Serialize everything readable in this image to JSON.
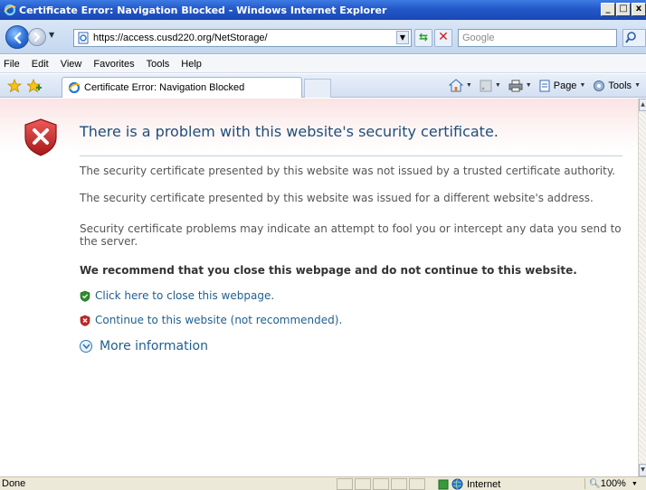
{
  "window": {
    "title": "Certificate Error: Navigation Blocked - Windows Internet Explorer",
    "controls": [
      "_",
      "□",
      "x"
    ]
  },
  "address_bar": {
    "url": "https://access.cusd220.org/NetStorage/",
    "search_placeholder": "Google"
  },
  "menu": {
    "items": [
      "File",
      "Edit",
      "View",
      "Favorites",
      "Tools",
      "Help"
    ]
  },
  "tab": {
    "title": "Certificate Error: Navigation Blocked"
  },
  "command_bar": {
    "page_label": "Page",
    "tools_label": "Tools"
  },
  "content": {
    "headline": "There is a problem with this website's security certificate.",
    "paragraph_1": "The security certificate presented by this website was not issued by a trusted certificate authority.",
    "paragraph_2": "The security certificate presented by this website was issued for a different website's address.",
    "paragraph_3": "Security certificate problems may indicate an attempt to fool you or intercept any data you send to the server.",
    "recommendation": "We recommend that you close this webpage and do not continue to this website.",
    "close_link": "Click here to close this webpage.",
    "continue_link": "Continue to this website (not recommended).",
    "more_info": "More information"
  },
  "status_bar": {
    "status": "Done",
    "zone": "Internet",
    "zoom": "100%"
  },
  "colors": {
    "titlebar": "#2358c9",
    "headline": "#1f4e79",
    "link": "#1f5f8f",
    "shield_red": "#c62828",
    "shield_green": "#2e8b2e"
  }
}
